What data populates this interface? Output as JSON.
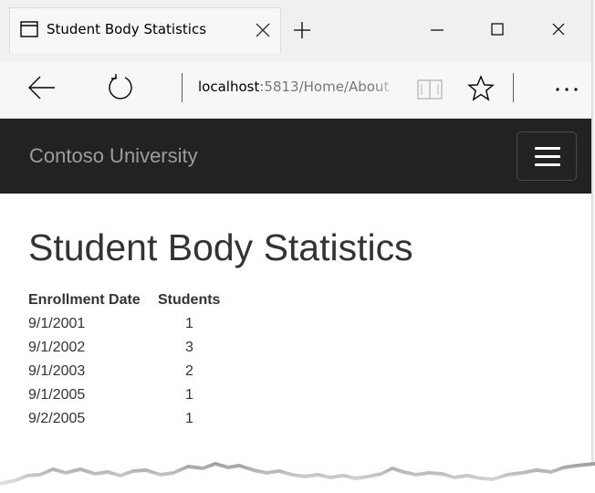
{
  "browser": {
    "tab_title": "Student Body Statistics",
    "url_host": "localhost",
    "url_rest": ":5813/Home/About"
  },
  "navbar": {
    "brand": "Contoso University"
  },
  "page": {
    "heading": "Student Body Statistics",
    "columns": [
      "Enrollment Date",
      "Students"
    ],
    "rows": [
      {
        "date": "9/1/2001",
        "students": "1"
      },
      {
        "date": "9/1/2002",
        "students": "3"
      },
      {
        "date": "9/1/2003",
        "students": "2"
      },
      {
        "date": "9/1/2005",
        "students": "1"
      },
      {
        "date": "9/2/2005",
        "students": "1"
      }
    ]
  }
}
